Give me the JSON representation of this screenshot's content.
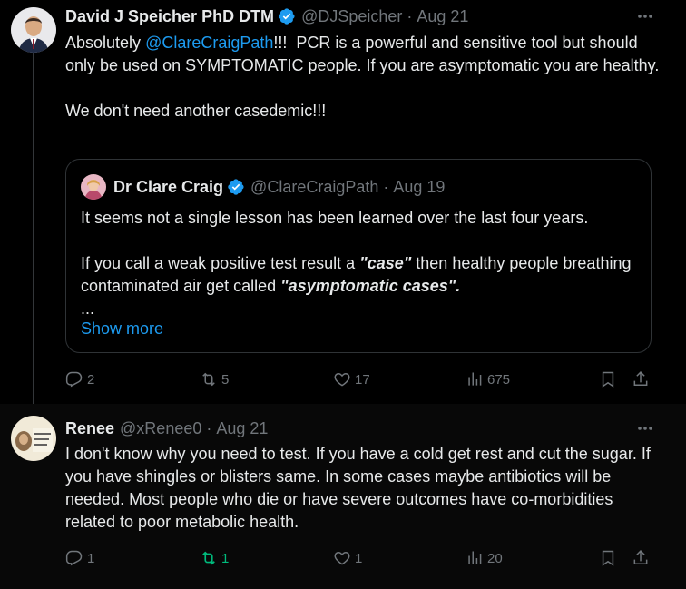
{
  "tweet1": {
    "author_name": "David J Speicher PhD DTM",
    "handle": "@DJSpeicher",
    "separator": "·",
    "date": "Aug 21",
    "text_before_mention": "Absolutely ",
    "mention": "@ClareCraigPath",
    "text_after_mention": "!!!  PCR is a powerful and sensitive tool but should only be used on SYMPTOMATIC people. If you are asymptomatic you are healthy.\n\nWe don't need another casedemic!!!",
    "quote": {
      "author_name": "Dr Clare Craig",
      "handle": "@ClareCraigPath",
      "separator": "·",
      "date": "Aug 19",
      "line1": "It seems not a single lesson has been learned over the last four years.",
      "line2_a": "If you call a weak positive test result a ",
      "line2_em1": "\"case\"",
      "line2_b": " then healthy people breathing contaminated air get called ",
      "line2_em2": "\"asymptomatic cases\".",
      "ellipsis": "...",
      "show_more": "Show more"
    },
    "actions": {
      "replies": "2",
      "reposts": "5",
      "likes": "17",
      "views": "675"
    }
  },
  "tweet2": {
    "author_name": "Renee",
    "handle": "@xRenee0",
    "separator": "·",
    "date": "Aug 21",
    "text": "I don't know why you need to test. If you have a cold get rest and cut the sugar. If you have shingles or blisters same. In some cases maybe antibiotics will be needed. Most people who die or have severe outcomes have co-morbidities related to poor metabolic health.",
    "actions": {
      "replies": "1",
      "reposts": "1",
      "likes": "1",
      "views": "20"
    }
  },
  "colors": {
    "background": "#000000",
    "text": "#e7e9ea",
    "muted": "#71767b",
    "link": "#1d9bf0",
    "verified": "#1d9bf0",
    "repost_active": "#00ba7c",
    "border": "#2f3336"
  }
}
